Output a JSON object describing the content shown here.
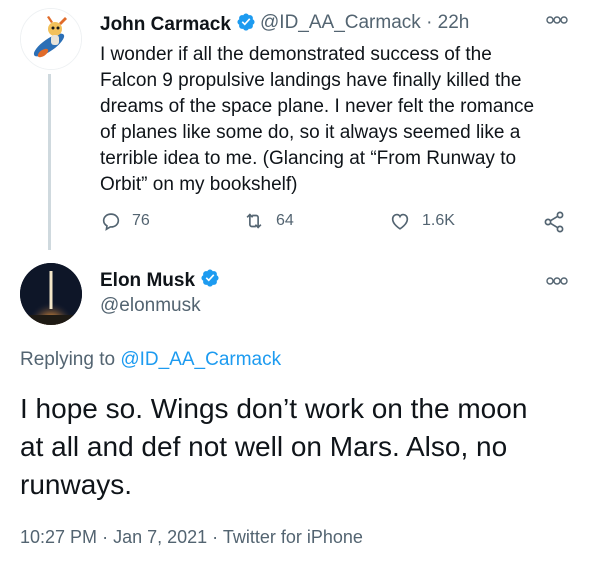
{
  "tweet1": {
    "author_name": "John Carmack",
    "handle": "@ID_AA_Carmack",
    "separator": "·",
    "time": "22h",
    "text_lines": [
      "I wonder if all the demonstrated success of the",
      "Falcon 9 propulsive landings have finally killed the",
      "dreams of the space plane. I never felt the romance",
      "of planes like some do, so it always seemed like a",
      "terrible idea to me. (Glancing at “From Runway to",
      "Orbit” on my bookshelf)"
    ],
    "actions": {
      "replies": "76",
      "retweets": "64",
      "likes": "1.6K"
    }
  },
  "tweet2": {
    "author_name": "Elon Musk",
    "handle": "@elonmusk",
    "replying_prefix": "Replying to",
    "replying_handle": "@ID_AA_Carmack",
    "text_lines": [
      "I hope so. Wings don’t work on the moon",
      "at all and def not well on Mars. Also, no",
      "runways."
    ],
    "time": "10:27 PM",
    "date": "Jan 7, 2021",
    "source": "Twitter for iPhone",
    "separator": "·"
  },
  "colors": {
    "text": "#0f1419",
    "secondary": "#536471",
    "link": "#1d9bf0",
    "verified": "#1d9bf0",
    "thread_line": "#cfd9de"
  },
  "icons": {
    "verified": "verified-badge-icon",
    "more": "more-options-icon",
    "reply": "reply-icon",
    "retweet": "retweet-icon",
    "like": "heart-icon",
    "share": "share-icon"
  }
}
